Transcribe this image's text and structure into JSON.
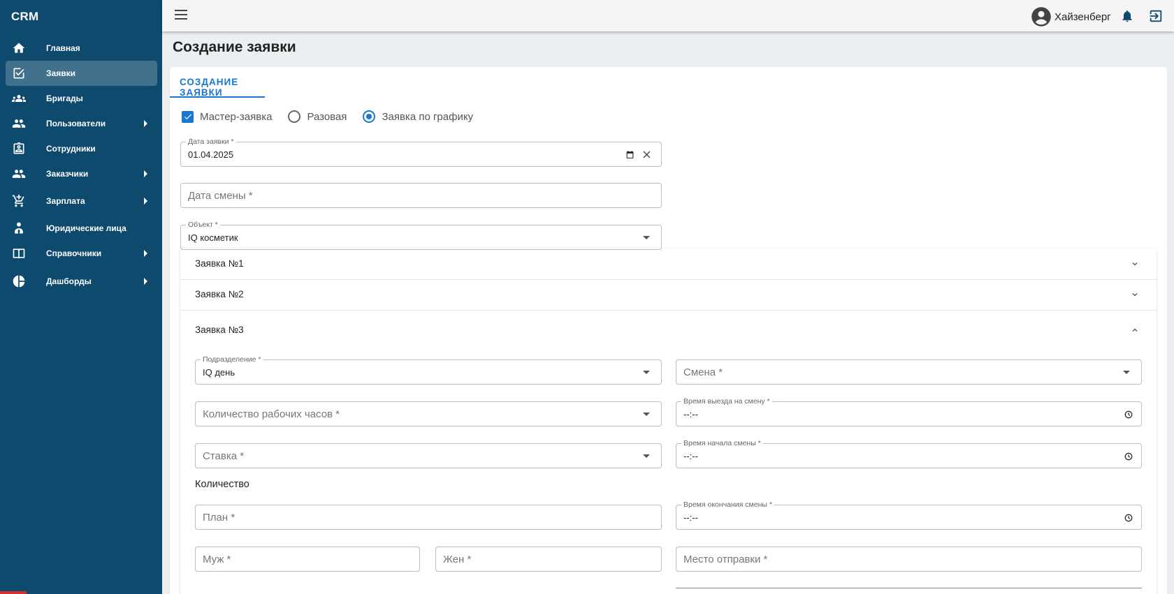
{
  "app": {
    "brand": "CRM"
  },
  "sidebar": {
    "items": [
      {
        "label": "Главная",
        "icon": "home-icon",
        "active": false,
        "arrow": false
      },
      {
        "label": "Заявки",
        "icon": "checkbox-icon",
        "active": true,
        "arrow": false
      },
      {
        "label": "Бригады",
        "icon": "groups-icon",
        "active": false,
        "arrow": false
      },
      {
        "label": "Пользователи",
        "icon": "people-icon",
        "active": false,
        "arrow": true
      },
      {
        "label": "Сотрудники",
        "icon": "badge-icon",
        "active": false,
        "arrow": false
      },
      {
        "label": "Заказчики",
        "icon": "people-icon",
        "active": false,
        "arrow": true
      },
      {
        "label": "Зарплата",
        "icon": "cart-icon",
        "active": false,
        "arrow": true
      },
      {
        "label": "Юридические лица",
        "icon": "person-tie-icon",
        "active": false,
        "arrow": false
      },
      {
        "label": "Справочники",
        "icon": "book-icon",
        "active": false,
        "arrow": true
      },
      {
        "label": "Дашборды",
        "icon": "pie-chart-icon",
        "active": false,
        "arrow": true
      }
    ]
  },
  "topbar": {
    "user_name": "Хайзенберг"
  },
  "page": {
    "title": "Создание заявки"
  },
  "tabs": [
    {
      "label": "СОЗДАНИЕ ЗАЯВКИ",
      "active": true
    }
  ],
  "options": {
    "master_label": "Мастер-заявка",
    "master_checked": true,
    "once_label": "Разовая",
    "schedule_label": "Заявка по графику",
    "selected": "schedule"
  },
  "form": {
    "request_date": {
      "label": "Дата заявки *",
      "value": "01.04.2025"
    },
    "shift_date": {
      "placeholder": "Дата смены *"
    },
    "object": {
      "label": "Объект *",
      "value": "IQ косметик"
    }
  },
  "accordion": {
    "items": [
      {
        "title": "Заявка №1",
        "expanded": false
      },
      {
        "title": "Заявка №2",
        "expanded": false
      },
      {
        "title": "Заявка №3",
        "expanded": true
      }
    ]
  },
  "request3": {
    "division": {
      "label": "Подразделение *",
      "value": "IQ день"
    },
    "shift": {
      "placeholder": "Смена *"
    },
    "work_hours": {
      "placeholder": "Количество рабочих часов *"
    },
    "departure_time": {
      "label": "Время выезда на смену *",
      "value": "--:--"
    },
    "rate": {
      "placeholder": "Ставка *"
    },
    "start_time": {
      "label": "Время начала смены *",
      "value": "--:--"
    },
    "quantity_label": "Количество",
    "plan": {
      "placeholder": "План *"
    },
    "end_time": {
      "label": "Время окончания смены *",
      "value": "--:--"
    },
    "male": {
      "placeholder": "Муж *"
    },
    "female": {
      "placeholder": "Жен *"
    },
    "departure_place": {
      "placeholder": "Место отправки *"
    }
  },
  "colors": {
    "sidebar": "#0e4a6e",
    "accent": "#1976d2",
    "background": "#eceff1"
  }
}
